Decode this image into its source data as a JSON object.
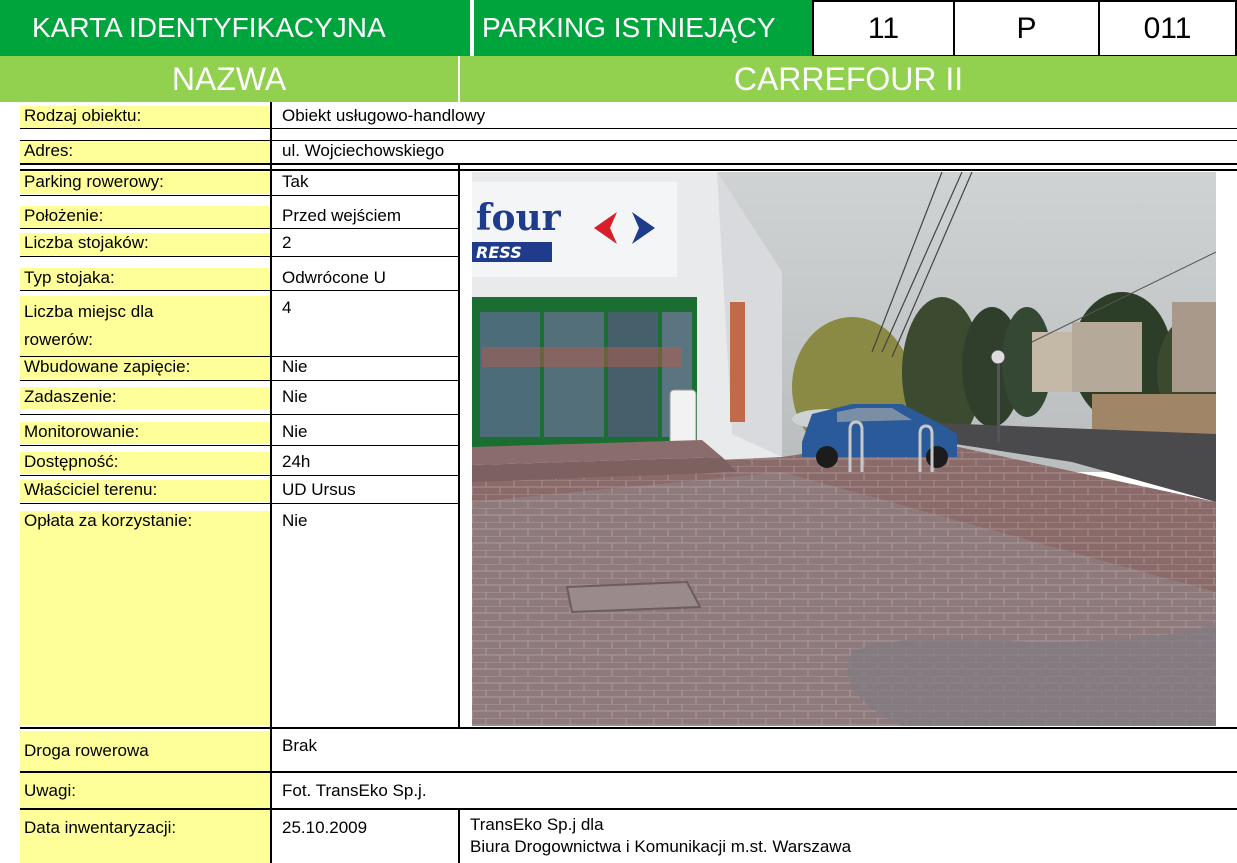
{
  "header": {
    "title": "KARTA IDENTYFIKACYJNA",
    "category": "PARKING ISTNIEJĄCY",
    "code_num": "11",
    "code_letter": "P",
    "code_id": "011"
  },
  "name_row": {
    "label": "NAZWA",
    "value": "CARREFOUR II"
  },
  "object": {
    "type_label": "Rodzaj obiektu:",
    "type_value": "Obiekt usługowo-handlowy",
    "address_label": "Adres:",
    "address_value": "ul. Wojciechowskiego"
  },
  "fields": [
    {
      "label": "Parking rowerowy:",
      "value": "Tak"
    },
    {
      "label": "Położenie:",
      "value": "Przed wejściem"
    },
    {
      "label": "Liczba stojaków:",
      "value": "2"
    },
    {
      "label": "Typ stojaka:",
      "value": "Odwrócone U"
    },
    {
      "label": "Liczba miejsc dla rowerów:",
      "value": "4"
    },
    {
      "label": "Wbudowane zapięcie:",
      "value": "Nie"
    },
    {
      "label": "Zadaszenie:",
      "value": "Nie"
    },
    {
      "label": "Monitorowanie:",
      "value": "Nie"
    },
    {
      "label": "Dostępność:",
      "value": "24h"
    },
    {
      "label": "Właściciel terenu:",
      "value": "UD Ursus"
    },
    {
      "label": "Opłata za korzystanie:",
      "value": "Nie"
    }
  ],
  "photo": {
    "sign_text_1": "four",
    "sign_text_2": "RESS"
  },
  "footer": {
    "bike_road_label": "Droga rowerowa",
    "bike_road_value": "Brak",
    "notes_label": "Uwagi:",
    "notes_value": "Fot. TransEko Sp.j.",
    "date_label": "Data inwentaryzacji:",
    "date_value": "25.10.2009",
    "author_line1": "TransEko Sp.j dla",
    "author_line2": "Biura Drogownictwa i Komunikacji m.st. Warszawa"
  },
  "colors": {
    "header_green": "#00A43C",
    "light_green": "#92D050",
    "label_yellow": "#FFFF99"
  }
}
